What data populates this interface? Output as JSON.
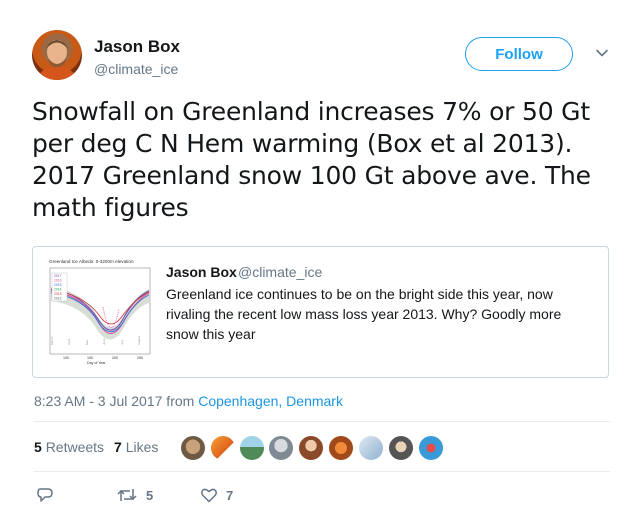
{
  "author": {
    "name": "Jason Box",
    "handle": "@climate_ice"
  },
  "follow_label": "Follow",
  "tweet_text": "Snowfall on Greenland increases 7% or 50 Gt per deg C N Hem warming (Box et al 2013). 2017 Greenland snow 100 Gt above ave. The math figures",
  "quoted": {
    "name": "Jason Box",
    "handle": "@climate_ice",
    "text": "Greenland ice continues to be on the bright side this year, now rivaling the recent low mass loss year 2013. Why? Goodly more snow this year",
    "thumbnail": {
      "title": "Greenland Ice Albedo: 0-3200m elevation",
      "xlabel": "Day of Year",
      "ticks": [
        "100",
        "150",
        "200",
        "250"
      ],
      "legend": [
        "2017",
        "2016",
        "2015",
        "2014",
        "2013",
        "2012"
      ],
      "months": [
        "March",
        "April",
        "May",
        "June",
        "July",
        "August"
      ]
    }
  },
  "meta": {
    "time": "8:23 AM - 3 Jul 2017 from ",
    "place": "Copenhagen, Denmark"
  },
  "stats": {
    "retweets_count": "5",
    "retweets_label": "Retweets",
    "likes_count": "7",
    "likes_label": "Likes"
  },
  "likers_icons": [
    "liker-avatar-1",
    "liker-avatar-2",
    "liker-avatar-3",
    "liker-avatar-4",
    "liker-avatar-5",
    "liker-avatar-6",
    "liker-avatar-7",
    "liker-avatar-8",
    "liker-avatar-9"
  ],
  "actions": {
    "retweet_count": "5",
    "like_count": "7"
  },
  "colors": {
    "accent": "#1da1f2",
    "link": "#1b95e0",
    "muted": "#657786",
    "text": "#14171a",
    "border": "#ccd6dd"
  }
}
